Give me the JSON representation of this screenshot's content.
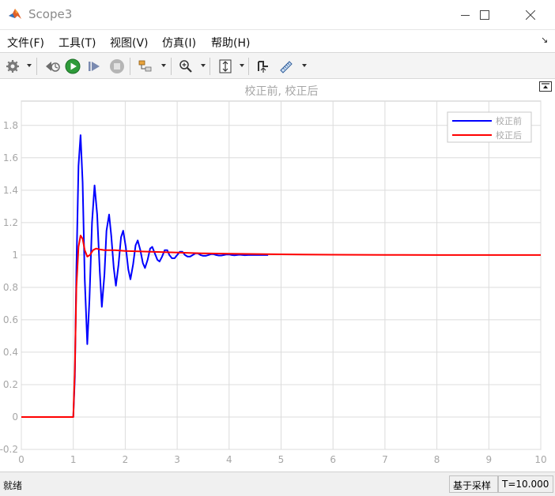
{
  "window": {
    "title": "Scope3"
  },
  "menu": [
    "文件(F)",
    "工具(T)",
    "视图(V)",
    "仿真(I)",
    "帮助(H)"
  ],
  "status": {
    "ready": "就绪",
    "sample_mode": "基于采样",
    "time": "T=10.000"
  },
  "colors": {
    "accent_blue": "#0000ff",
    "accent_red": "#ff0000",
    "axes_text": "#a6a6a6",
    "grid": "#dcdcdc"
  },
  "chart_data": {
    "type": "line",
    "title": "校正前, 校正后",
    "xlim": [
      0,
      10
    ],
    "ylim": [
      -0.2,
      1.95
    ],
    "xticks": [
      0,
      1,
      2,
      3,
      4,
      5,
      6,
      7,
      8,
      9,
      10
    ],
    "yticks": [
      -0.2,
      0,
      0.2,
      0.4,
      0.6,
      0.8,
      1,
      1.2,
      1.4,
      1.6,
      1.8
    ],
    "grid": true,
    "legend_position": "top-right",
    "series": [
      {
        "name": "校正前",
        "color": "#0000ff",
        "x": [
          0,
          1.0,
          1.03,
          1.06,
          1.1,
          1.14,
          1.18,
          1.22,
          1.27,
          1.31,
          1.36,
          1.41,
          1.46,
          1.51,
          1.55,
          1.6,
          1.64,
          1.69,
          1.73,
          1.78,
          1.82,
          1.87,
          1.92,
          1.96,
          2.01,
          2.06,
          2.1,
          2.15,
          2.2,
          2.24,
          2.29,
          2.34,
          2.38,
          2.43,
          2.48,
          2.52,
          2.57,
          2.62,
          2.66,
          2.71,
          2.76,
          2.81,
          2.85,
          2.9,
          2.95,
          3.0,
          3.05,
          3.1,
          3.15,
          3.2,
          3.25,
          3.3,
          3.35,
          3.4,
          3.45,
          3.5,
          3.55,
          3.6,
          3.65,
          3.7,
          3.75,
          3.8,
          3.85,
          3.9,
          3.95,
          4.0,
          4.05,
          4.1,
          4.2,
          4.3,
          4.4,
          4.5,
          4.6,
          4.75
        ],
        "y": [
          0,
          0,
          0.25,
          0.9,
          1.55,
          1.74,
          1.45,
          0.85,
          0.45,
          0.72,
          1.2,
          1.43,
          1.25,
          0.9,
          0.68,
          0.88,
          1.15,
          1.25,
          1.12,
          0.92,
          0.81,
          0.94,
          1.11,
          1.15,
          1.05,
          0.91,
          0.85,
          0.94,
          1.06,
          1.09,
          1.03,
          0.95,
          0.92,
          0.97,
          1.04,
          1.05,
          1.01,
          0.97,
          0.96,
          0.99,
          1.03,
          1.03,
          1.0,
          0.98,
          0.98,
          1.0,
          1.02,
          1.02,
          1.0,
          0.99,
          0.99,
          1.0,
          1.01,
          1.01,
          1.0,
          0.995,
          0.995,
          1.0,
          1.005,
          1.005,
          1.0,
          0.997,
          0.997,
          1.0,
          1.003,
          1.003,
          1.0,
          0.998,
          1.002,
          0.999,
          1.001,
          1.0,
          1.0,
          1.0
        ]
      },
      {
        "name": "校正后",
        "color": "#ff0000",
        "x": [
          0,
          1.0,
          1.03,
          1.06,
          1.1,
          1.14,
          1.18,
          1.22,
          1.27,
          1.32,
          1.38,
          1.44,
          1.5,
          1.6,
          1.8,
          2.0,
          2.5,
          3.0,
          3.5,
          4.0,
          5.0,
          6.0,
          7.0,
          8.0,
          9.0,
          10.0
        ],
        "y": [
          0,
          0,
          0.3,
          0.8,
          1.05,
          1.12,
          1.1,
          1.03,
          0.99,
          1.0,
          1.03,
          1.04,
          1.035,
          1.03,
          1.03,
          1.025,
          1.02,
          1.015,
          1.01,
          1.008,
          1.004,
          1.002,
          1.001,
          1.0,
          1.0,
          1.0
        ]
      }
    ]
  }
}
